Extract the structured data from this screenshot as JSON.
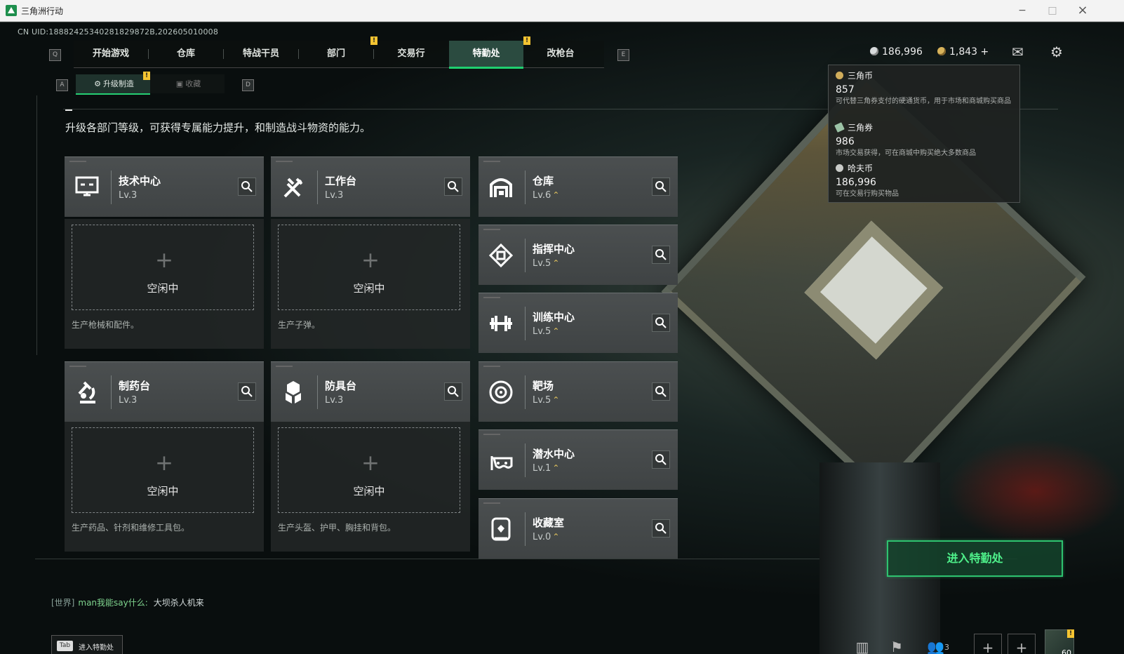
{
  "window": {
    "title": "三角洲行动",
    "minimize": "−",
    "maximize": "□",
    "close": "×"
  },
  "game": {
    "uid": "CN UID:18882425340281829872B,202605010008",
    "nav": {
      "left_key": "Q",
      "right_key": "E",
      "tabs": [
        "开始游戏",
        "仓库",
        "特战干员",
        "部门",
        "交易行",
        "特勤处",
        "改枪台"
      ],
      "active_tab": "特勤处",
      "alerts": [
        "!",
        "!"
      ]
    },
    "subnav": {
      "left_key": "A",
      "right_key": "D",
      "tabs": [
        "升级制造",
        "收藏"
      ],
      "active_tab": "升级制造",
      "alert": "!"
    },
    "currency": {
      "balance_one": "186,996",
      "balance_two": "1,843",
      "plus": "+"
    },
    "top_icons": {
      "mail": "✉",
      "settings": "⚙"
    },
    "tooltip": {
      "items": [
        {
          "name": "三角币",
          "value": "857",
          "description": "可代替三角券支付的硬通货币，用于市场和商城购买商品"
        },
        {
          "name": "三角券",
          "value": "986",
          "description": "市场交易获得，可在商城中购买绝大多数商品"
        },
        {
          "name": "哈夫币",
          "value": "186,996",
          "description": "可在交易行购买物品"
        }
      ]
    },
    "page_description": "升级各部门等级，可获得专属能力提升，和制造战斗物资的能力。",
    "facilities": [
      {
        "name": "技术中心",
        "level": "Lv.3",
        "upgrade": false,
        "icon": "monitor-icon"
      },
      {
        "name": "工作台",
        "level": "Lv.3",
        "upgrade": false,
        "icon": "tools-icon"
      },
      {
        "name": "仓库",
        "level": "Lv.6",
        "upgrade": true,
        "icon": "warehouse-icon"
      },
      {
        "name": "指挥中心",
        "level": "Lv.5",
        "upgrade": true,
        "icon": "command-icon"
      },
      {
        "name": "训练中心",
        "level": "Lv.5",
        "upgrade": true,
        "icon": "dumbbell-icon"
      },
      {
        "name": "制药台",
        "level": "Lv.3",
        "upgrade": false,
        "icon": "microscope-icon"
      },
      {
        "name": "防具台",
        "level": "Lv.3",
        "upgrade": false,
        "icon": "armor-icon"
      },
      {
        "name": "靶场",
        "level": "Lv.5",
        "upgrade": true,
        "icon": "target-icon"
      },
      {
        "name": "潜水中心",
        "level": "Lv.1",
        "upgrade": true,
        "icon": "diving-mask-icon"
      },
      {
        "name": "收藏室",
        "level": "Lv.0",
        "upgrade": true,
        "icon": "collection-icon"
      }
    ],
    "production_slots": [
      {
        "status": "空闲中",
        "description": "生产枪械和配件。"
      },
      {
        "status": "空闲中",
        "description": "生产子弹。"
      },
      {
        "status": "空闲中",
        "description": "生产药品、针剂和维修工具包。"
      },
      {
        "status": "空闲中",
        "description": "生产头盔、护甲、胸挂和背包。"
      }
    ],
    "enter_button": "进入特勤处",
    "chat": {
      "channel": "[世界]",
      "player": "man我能say什么:",
      "message": "大坝杀人机来"
    },
    "tab_hint": {
      "key": "Tab",
      "text": "进入特勤处"
    },
    "bottom": {
      "friend_count": "3",
      "avatar_level": "60",
      "avatar_alert": "!"
    },
    "colors": {
      "accent": "#25ce73",
      "highlight": "#f5c431",
      "card": "#464a4b"
    }
  }
}
